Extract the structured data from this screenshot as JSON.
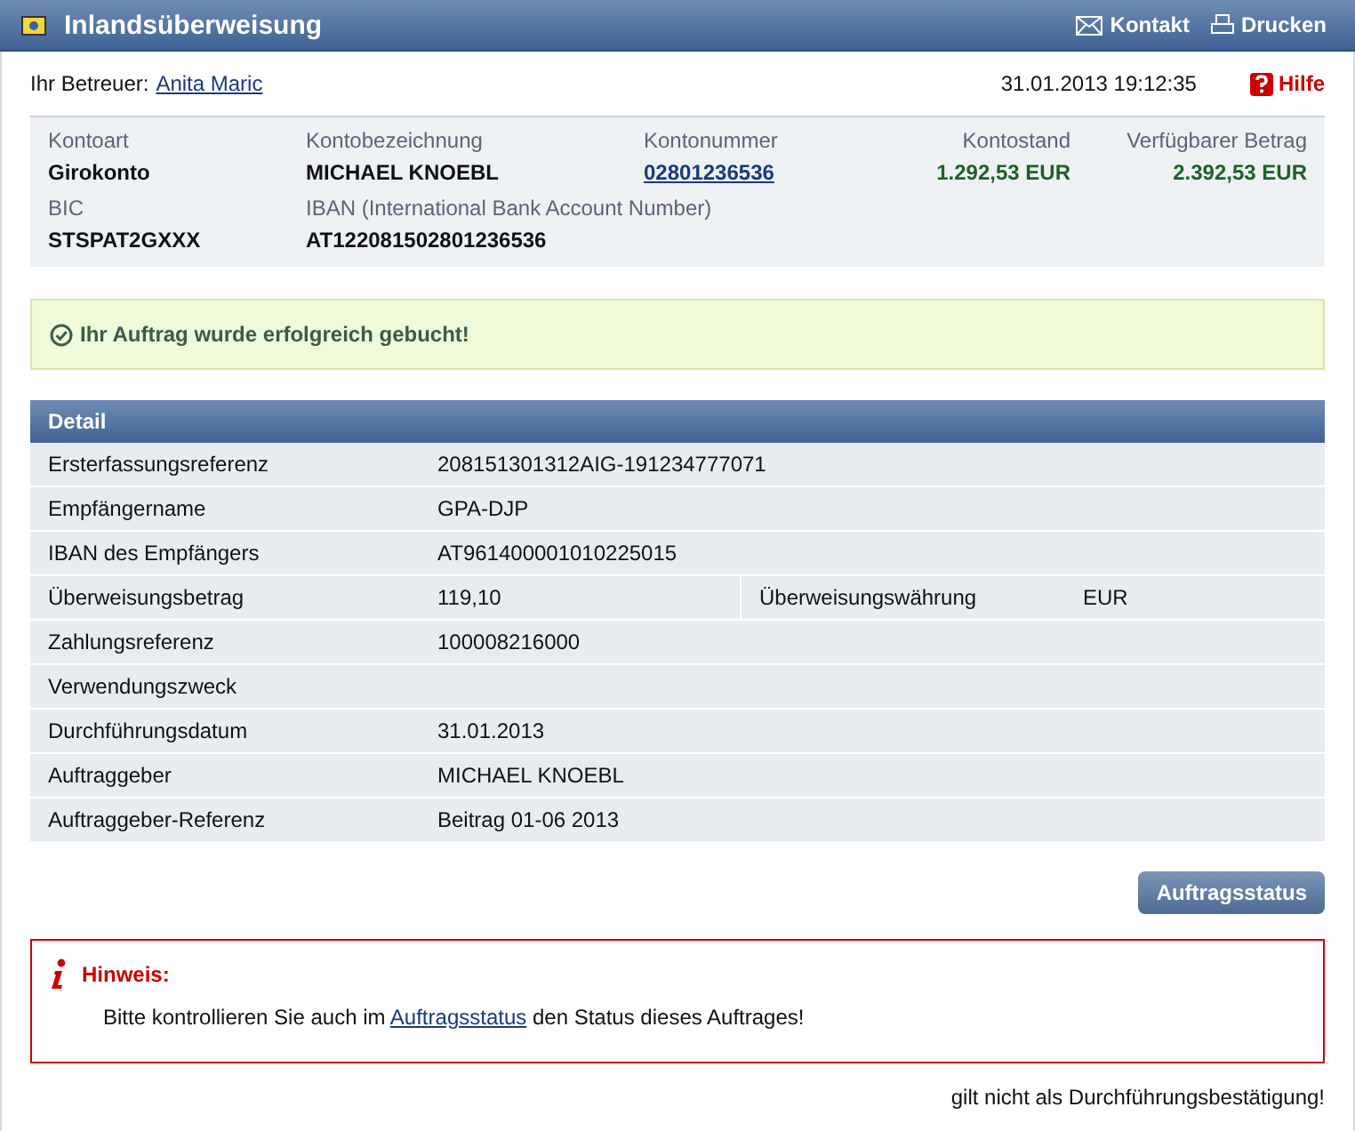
{
  "window": {
    "title": "Inlandsüberweisung",
    "actions": [
      {
        "kind": "mail",
        "label": "Kontakt"
      },
      {
        "kind": "print",
        "label": "Drucken"
      }
    ]
  },
  "advisor": {
    "label": "Ihr Betreuer:",
    "name": "Anita Maric"
  },
  "timestamp": "31.01.2013 19:12:35",
  "help": "Hilfe",
  "account": {
    "fields": [
      {
        "label": "Kontoart",
        "value": "Girokonto",
        "kind": "text"
      },
      {
        "label": "Kontobezeichnung",
        "value": "MICHAEL KNOEBL",
        "kind": "text"
      },
      {
        "label": "Kontonummer",
        "value": "02801236536",
        "kind": "link"
      },
      {
        "label": "Kontostand",
        "value": "1.292,53 EUR",
        "kind": "amount"
      },
      {
        "label": "Verfügbarer Betrag",
        "value": "2.392,53 EUR",
        "kind": "amount"
      },
      {
        "label": "BIC",
        "value": "STSPAT2GXXX",
        "kind": "text"
      },
      {
        "label": "IBAN (International Bank Account Number)",
        "value": "AT122081502801236536",
        "kind": "text"
      }
    ]
  },
  "success": "Ihr Auftrag wurde erfolgreich gebucht!",
  "detail": {
    "title": "Detail",
    "rows": [
      {
        "label": "Ersterfassungsreferenz",
        "value": "208151301312AIG-191234777071"
      },
      {
        "label": "Empfängername",
        "value": "GPA-DJP"
      },
      {
        "label": "IBAN des Empfängers",
        "value": "AT961400001010225015"
      },
      {
        "label": "Überweisungsbetrag",
        "value": "119,10",
        "label_2": "Überweisungswährung",
        "value_2": "EUR"
      },
      {
        "label": "Zahlungsreferenz",
        "value": "100008216000"
      },
      {
        "label": "Verwendungszweck"
      },
      {
        "label": "Durchführungsdatum",
        "value": "31.01.2013"
      },
      {
        "label": "Auftraggeber",
        "value": "MICHAEL KNOEBL"
      },
      {
        "label": "Auftraggeber-Referenz",
        "value": "Beitrag 01-06 2013"
      }
    ]
  },
  "status_button": "Auftragsstatus",
  "notice": {
    "title": "Hinweis:",
    "text_before": "Bitte kontrollieren Sie auch im ",
    "link": "Auftragsstatus",
    "text_after": " den Status dieses Auftrages!"
  },
  "footer": "gilt nicht als Durchführungsbestätigung!"
}
